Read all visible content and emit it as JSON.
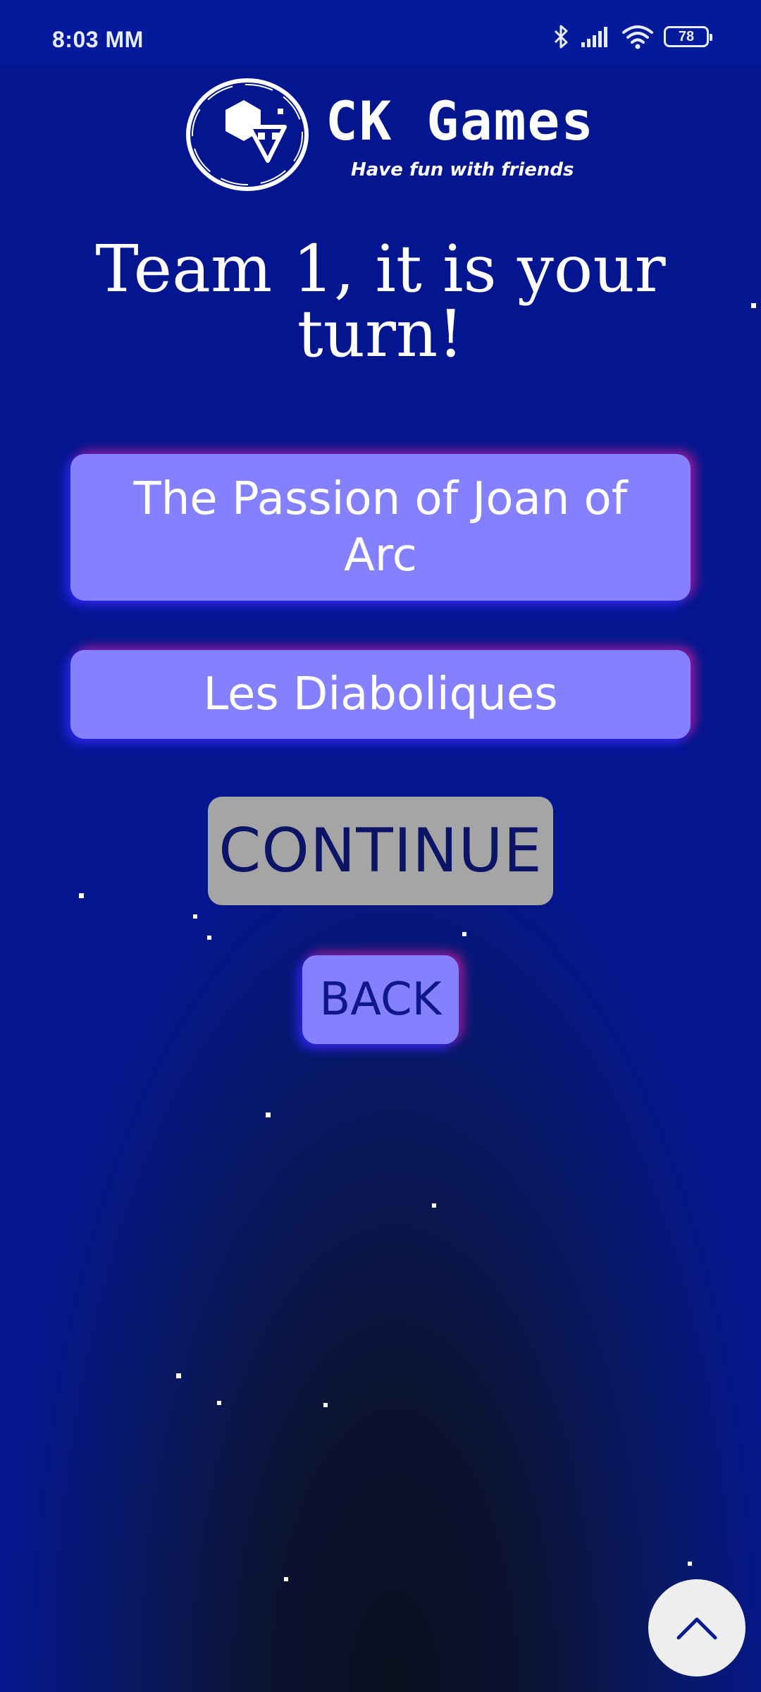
{
  "status_bar": {
    "time": "8:03 MM",
    "battery_level": "78",
    "icons": [
      "bluetooth-icon",
      "signal-icon",
      "wifi-icon",
      "battery-icon"
    ]
  },
  "logo": {
    "name": "CK Games",
    "tagline": "Have fun with friends",
    "icon": "ck-games-logo-icon"
  },
  "title": "Team 1, it is your turn!",
  "options": [
    {
      "label": "The Passion of Joan of Arc"
    },
    {
      "label": "Les Diaboliques"
    }
  ],
  "buttons": {
    "continue_label": "CONTINUE",
    "back_label": "BACK",
    "scroll_top_icon": "chevron-up-icon"
  },
  "colors": {
    "background": "#041592",
    "option_fill": "#8480fe",
    "continue_fill": "#a5a5a5",
    "glow_blue": "#2828ff",
    "glow_pink": "#e61e8c"
  }
}
